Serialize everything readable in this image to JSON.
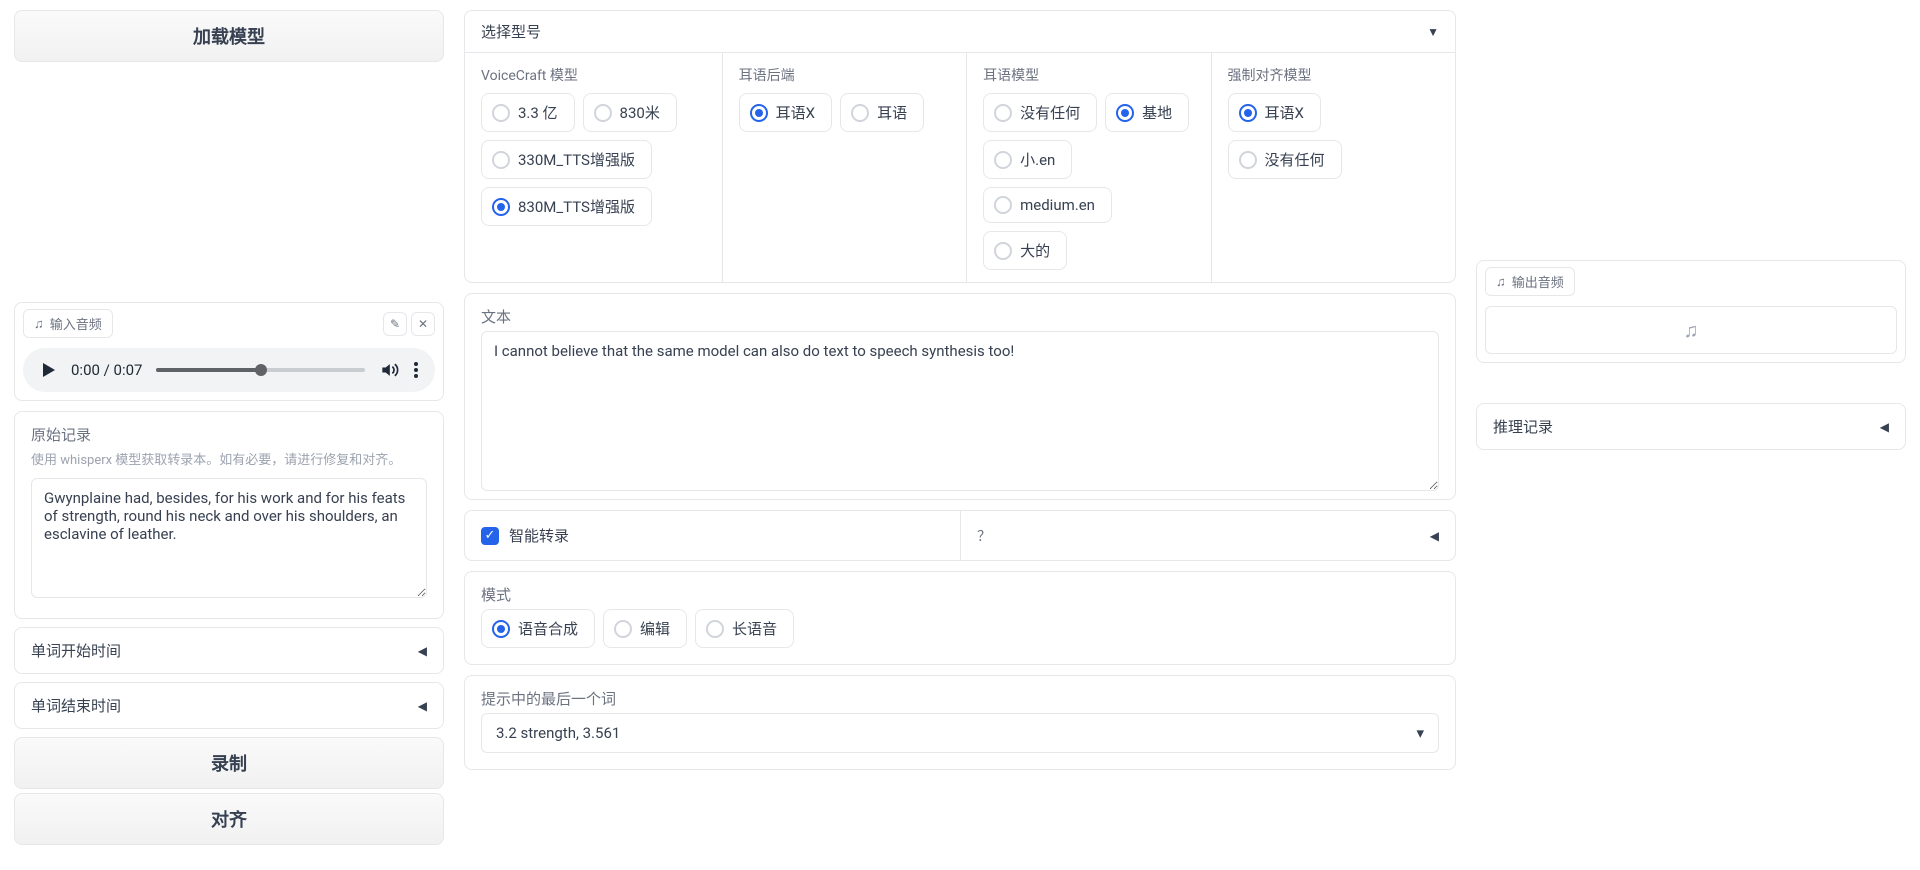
{
  "left": {
    "loadModelBtn": "加载模型",
    "inputAudio": {
      "chip": "输入音频",
      "time": "0:00 / 0:07"
    },
    "originalRecord": {
      "label": "原始记录",
      "hint": "使用 whisperx 模型获取转录本。如有必要，请进行修复和对齐。",
      "value": "Gwynplaine had, besides, for his work and for his feats of strength, round his neck and over his shoulders, an esclavine of leather."
    },
    "rows": {
      "wordStart": "单词开始时间",
      "wordEnd": "单词结束时间"
    },
    "recordBtn": "录制",
    "alignBtn": "对齐"
  },
  "topPanel": {
    "title": "选择型号",
    "cols": {
      "voicecraft": {
        "label": "VoiceCraft 模型",
        "options": [
          "3.3 亿",
          "830米",
          "330M_TTS增强版",
          "830M_TTS增强版"
        ],
        "selected": "830M_TTS增强版"
      },
      "whisperBackend": {
        "label": "耳语后端",
        "options": [
          "耳语X",
          "耳语"
        ],
        "selected": "耳语X"
      },
      "whisperModel": {
        "label": "耳语模型",
        "options": [
          "没有任何",
          "基地",
          "小.en",
          "medium.en",
          "大的"
        ],
        "selected": "基地"
      },
      "alignModel": {
        "label": "强制对齐模型",
        "options": [
          "耳语X",
          "没有任何"
        ],
        "selected": "耳语X"
      }
    }
  },
  "center": {
    "textLabel": "文本",
    "textValue": "I cannot believe that the same model can also do text to speech synthesis too!",
    "smartTranscribe": "智能转录",
    "question": "？",
    "modeLabel": "模式",
    "modes": [
      "语音合成",
      "编辑",
      "长语音"
    ],
    "modeSelected": "语音合成",
    "lastWordLabel": "提示中的最后一个词",
    "lastWordValue": "3.2 strength, 3.561"
  },
  "right": {
    "outputAudio": "输出音频",
    "inferenceRecord": "推理记录"
  }
}
